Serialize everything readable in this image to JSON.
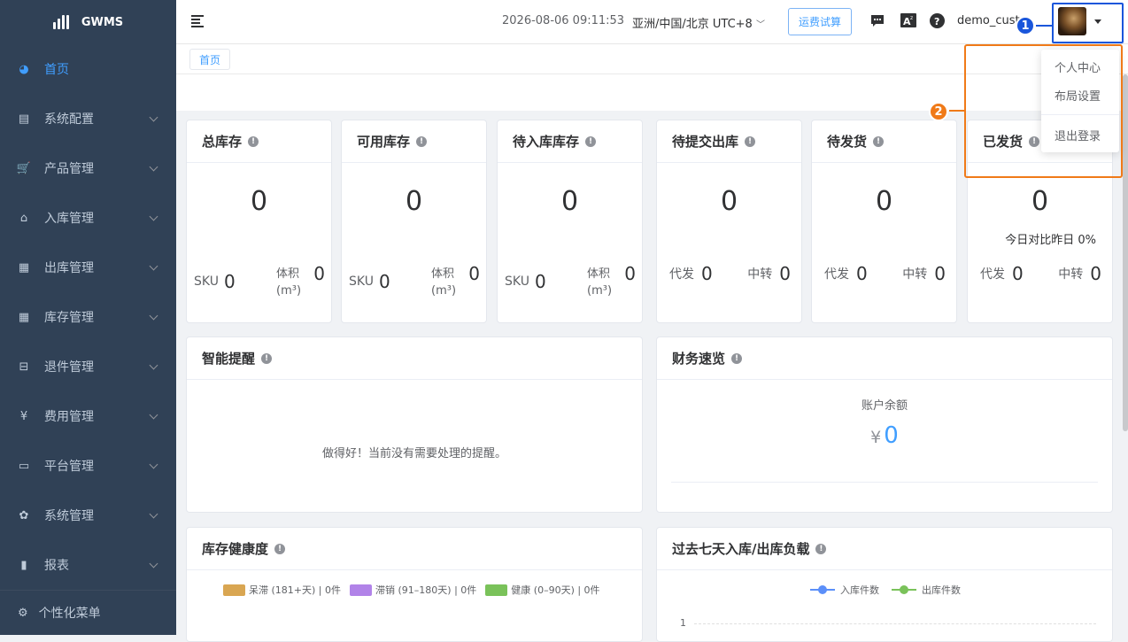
{
  "app": {
    "name": "GWMS"
  },
  "sidebar": {
    "items": [
      {
        "label": "首页",
        "icon": "dashboard-icon",
        "active": true
      },
      {
        "label": "系统配置",
        "icon": "config-icon"
      },
      {
        "label": "产品管理",
        "icon": "cart-icon"
      },
      {
        "label": "入库管理",
        "icon": "home-icon"
      },
      {
        "label": "出库管理",
        "icon": "grid-icon"
      },
      {
        "label": "库存管理",
        "icon": "table-icon"
      },
      {
        "label": "退件管理",
        "icon": "return-icon"
      },
      {
        "label": "费用管理",
        "icon": "yen-icon"
      },
      {
        "label": "平台管理",
        "icon": "platform-icon"
      },
      {
        "label": "系统管理",
        "icon": "settings-icon"
      },
      {
        "label": "报表",
        "icon": "chart-icon"
      }
    ],
    "bottom": {
      "label": "个性化菜单",
      "icon": "gear-icon"
    }
  },
  "header": {
    "datetime": "2026-08-06 09:11:53",
    "timezone": "亚洲/中国/北京 UTC+8",
    "trial_button": "运费试算",
    "username": "demo_customer",
    "icons": [
      "chat-icon",
      "translate-icon",
      "help-icon"
    ]
  },
  "tags": [
    "首页"
  ],
  "stats": [
    {
      "title": "总库存",
      "value": "0",
      "sku_label": "SKU",
      "sku": "0",
      "vol_label": "体积",
      "vol_unit": "(m³)",
      "vol": "0"
    },
    {
      "title": "可用库存",
      "value": "0",
      "sku_label": "SKU",
      "sku": "0",
      "vol_label": "体积",
      "vol_unit": "(m³)",
      "vol": "0"
    },
    {
      "title": "待入库库存",
      "value": "0",
      "sku_label": "SKU",
      "sku": "0",
      "vol_label": "体积",
      "vol_unit": "(m³)",
      "vol": "0"
    },
    {
      "title": "待提交出库",
      "value": "0",
      "a_label": "代发",
      "a": "0",
      "b_label": "中转",
      "b": "0"
    },
    {
      "title": "待发货",
      "value": "0",
      "a_label": "代发",
      "a": "0",
      "b_label": "中转",
      "b": "0"
    },
    {
      "title": "已发货",
      "value": "0",
      "compare": "今日对比昨日 0%",
      "a_label": "代发",
      "a": "0",
      "b_label": "中转",
      "b": "0"
    }
  ],
  "reminders": {
    "title": "智能提醒",
    "empty": "做得好！当前没有需要处理的提醒。"
  },
  "finance": {
    "title": "财务速览",
    "balance_label": "账户余额",
    "currency": "¥",
    "balance": "0"
  },
  "health": {
    "title": "库存健康度",
    "legend": [
      {
        "label": "呆滞 (181+天) | 0件",
        "color": "#d9a652"
      },
      {
        "label": "滞销 (91–180天) | 0件",
        "color": "#b183e8"
      },
      {
        "label": "健康 (0–90天) | 0件",
        "color": "#7ac25a"
      }
    ]
  },
  "load": {
    "title": "过去七天入库/出库负载",
    "legend": [
      {
        "label": "入库件数",
        "color": "#5b8ff9"
      },
      {
        "label": "出库件数",
        "color": "#7ac25a"
      }
    ],
    "y_tick": "1"
  },
  "dropdown": {
    "items": [
      "个人中心",
      "布局设置",
      "退出登录"
    ]
  },
  "annotations": {
    "badge1": "1",
    "badge2": "2",
    "colors": {
      "badge1": "#1a56db",
      "badge2": "#f07a18",
      "accent": "#409eff"
    }
  }
}
